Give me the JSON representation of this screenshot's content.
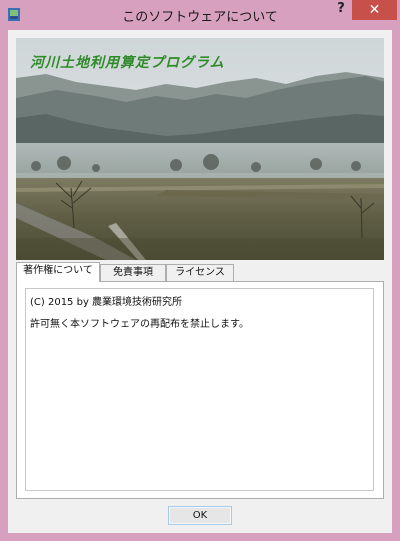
{
  "window": {
    "title": "このソフトウェアについて",
    "help_label": "?",
    "close_label": "✕"
  },
  "banner": {
    "title": "河川土地利用算定プログラム"
  },
  "tabs": [
    {
      "label": "著作権について",
      "active": true
    },
    {
      "label": "免責事項",
      "active": false
    },
    {
      "label": "ライセンス",
      "active": false
    }
  ],
  "content": {
    "lines": [
      "(C) 2015 by 農業環境技術研究所",
      "許可無く本ソフトウェアの再配布を禁止します。"
    ]
  },
  "ok_label": "OK",
  "colors": {
    "frame": "#d8a0bf",
    "close": "#c7504a",
    "banner_title": "#2f8a2a"
  }
}
